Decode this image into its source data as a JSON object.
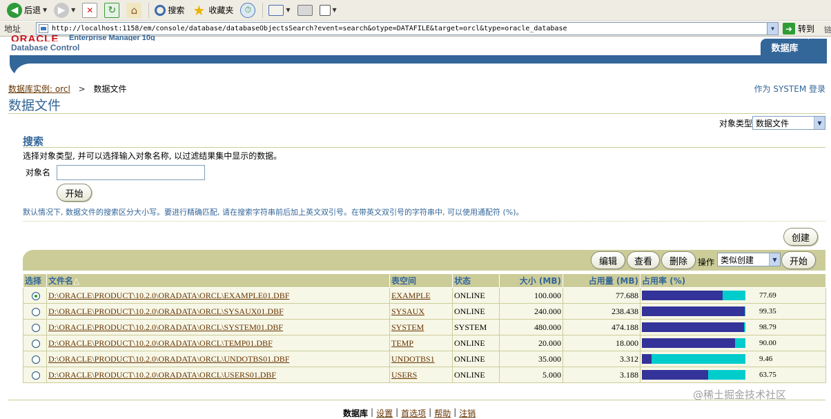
{
  "toolbar": {
    "back": "后退",
    "search": "搜索",
    "favorites": "收藏夹"
  },
  "address": {
    "label": "地址",
    "url": "http://localhost:1158/em/console/database/databaseObjectsSearch?event=search&otype=DATAFILE&target=orcl&type=oracle_database",
    "go": "转到",
    "links": "链"
  },
  "header": {
    "logo": "ORACLE",
    "product": "Enterprise Manager 10g",
    "subtitle": "Database Control",
    "tab": "数据库"
  },
  "breadcrumb": {
    "instance_link": "数据库实例: orcl",
    "separator": ">",
    "current": "数据文件"
  },
  "login_info": "作为 SYSTEM 登录",
  "page_title": "数据文件",
  "object_type": {
    "label": "对象类型",
    "value": "数据文件"
  },
  "search": {
    "title": "搜索",
    "description": "选择对象类型, 并可以选择输入对象名称, 以过滤结果集中显示的数据。",
    "object_name_label": "对象名",
    "object_name_value": "",
    "go_label": "开始",
    "hint": "默认情况下, 数据文件的搜索区分大小写。要进行精确匹配, 请在搜索字符串前后加上英文双引号。在带英文双引号的字符串中, 可以使用通配符 (%)。"
  },
  "actions": {
    "create": "创建",
    "edit": "编辑",
    "view": "查看",
    "delete": "删除",
    "operation_label": "操作",
    "operation_value": "类似创建",
    "go": "开始"
  },
  "table": {
    "headers": {
      "select": "选择",
      "filename": "文件名",
      "sort_indicator": "△",
      "tablespace": "表空间",
      "status": "状态",
      "size": "大小 (MB)",
      "used": "占用量 (MB)",
      "usage": "占用率 (%)"
    },
    "rows": [
      {
        "selected": true,
        "file": "D:\\ORACLE\\PRODUCT\\10.2.0\\ORADATA\\ORCL\\EXAMPLE01.DBF",
        "tablespace": "EXAMPLE",
        "status": "ONLINE",
        "size": "100.000",
        "used": "77.688",
        "usage": "77.69",
        "usage_pct": 77.69
      },
      {
        "selected": false,
        "file": "D:\\ORACLE\\PRODUCT\\10.2.0\\ORADATA\\ORCL\\SYSAUX01.DBF",
        "tablespace": "SYSAUX",
        "status": "ONLINE",
        "size": "240.000",
        "used": "238.438",
        "usage": "99.35",
        "usage_pct": 99.35
      },
      {
        "selected": false,
        "file": "D:\\ORACLE\\PRODUCT\\10.2.0\\ORADATA\\ORCL\\SYSTEM01.DBF",
        "tablespace": "SYSTEM",
        "status": "SYSTEM",
        "size": "480.000",
        "used": "474.188",
        "usage": "98.79",
        "usage_pct": 98.79
      },
      {
        "selected": false,
        "file": "D:\\ORACLE\\PRODUCT\\10.2.0\\ORADATA\\ORCL\\TEMP01.DBF",
        "tablespace": "TEMP",
        "status": "ONLINE",
        "size": "20.000",
        "used": "18.000",
        "usage": "90.00",
        "usage_pct": 90.0
      },
      {
        "selected": false,
        "file": "D:\\ORACLE\\PRODUCT\\10.2.0\\ORADATA\\ORCL\\UNDOTBS01.DBF",
        "tablespace": "UNDOTBS1",
        "status": "ONLINE",
        "size": "35.000",
        "used": "3.312",
        "usage": "9.46",
        "usage_pct": 9.46
      },
      {
        "selected": false,
        "file": "D:\\ORACLE\\PRODUCT\\10.2.0\\ORADATA\\ORCL\\USERS01.DBF",
        "tablespace": "USERS",
        "status": "ONLINE",
        "size": "5.000",
        "used": "3.188",
        "usage": "63.75",
        "usage_pct": 63.75
      }
    ]
  },
  "footer": {
    "links": [
      "数据库",
      "设置",
      "首选项",
      "帮助",
      "注销"
    ],
    "watermark": "@稀土掘金技术社区"
  },
  "colors": {
    "brand_blue": "#336699",
    "tan": "#cccc99",
    "link": "#663300",
    "bar_used": "#333399",
    "bar_free": "#00cccc"
  }
}
